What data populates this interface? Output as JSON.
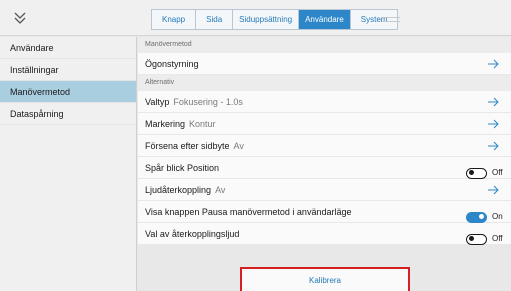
{
  "colors": {
    "accent": "#2d86c8",
    "sidebar_selected": "#a8cee0",
    "highlight_border": "#d42020",
    "tab_text": "#247ab8"
  },
  "header": {
    "collapse_icon": "double-chevron-down-icon",
    "tabs": [
      {
        "label": "Knapp",
        "active": false
      },
      {
        "label": "Sida",
        "active": false
      },
      {
        "label": "Siduppsättning",
        "active": false
      },
      {
        "label": "Användare",
        "active": true
      },
      {
        "label": "System",
        "active": false
      }
    ]
  },
  "sidebar": {
    "items": [
      {
        "label": "Användare",
        "selected": false
      },
      {
        "label": "Inställningar",
        "selected": false
      },
      {
        "label": "Manövermetod",
        "selected": true
      },
      {
        "label": "Dataspårning",
        "selected": false
      }
    ]
  },
  "main": {
    "section1": {
      "header": "Manövermetod",
      "row": {
        "label": "Ögonstyrning",
        "control": "arrow-right-icon"
      }
    },
    "section2": {
      "header": "Alternativ",
      "rows": [
        {
          "label": "Valtyp",
          "value": "Fokusering - 1.0s",
          "control": "arrow"
        },
        {
          "label": "Markering",
          "value": "Kontur",
          "control": "arrow"
        },
        {
          "label": "Försena efter sidbyte",
          "value": "Av",
          "control": "arrow"
        },
        {
          "label": "Spår blick Position",
          "value": "",
          "control": "toggle",
          "state": "Off"
        },
        {
          "label": "Ljudåterkoppling",
          "value": "Av",
          "control": "arrow"
        },
        {
          "label": "Visa knappen Pausa manövermetod i användarläge",
          "value": "",
          "control": "toggle",
          "state": "On"
        },
        {
          "label": "Val av återkopplingsljud",
          "value": "",
          "control": "toggle",
          "state": "Off"
        }
      ]
    },
    "calibrate_label": "Kalibrera"
  }
}
